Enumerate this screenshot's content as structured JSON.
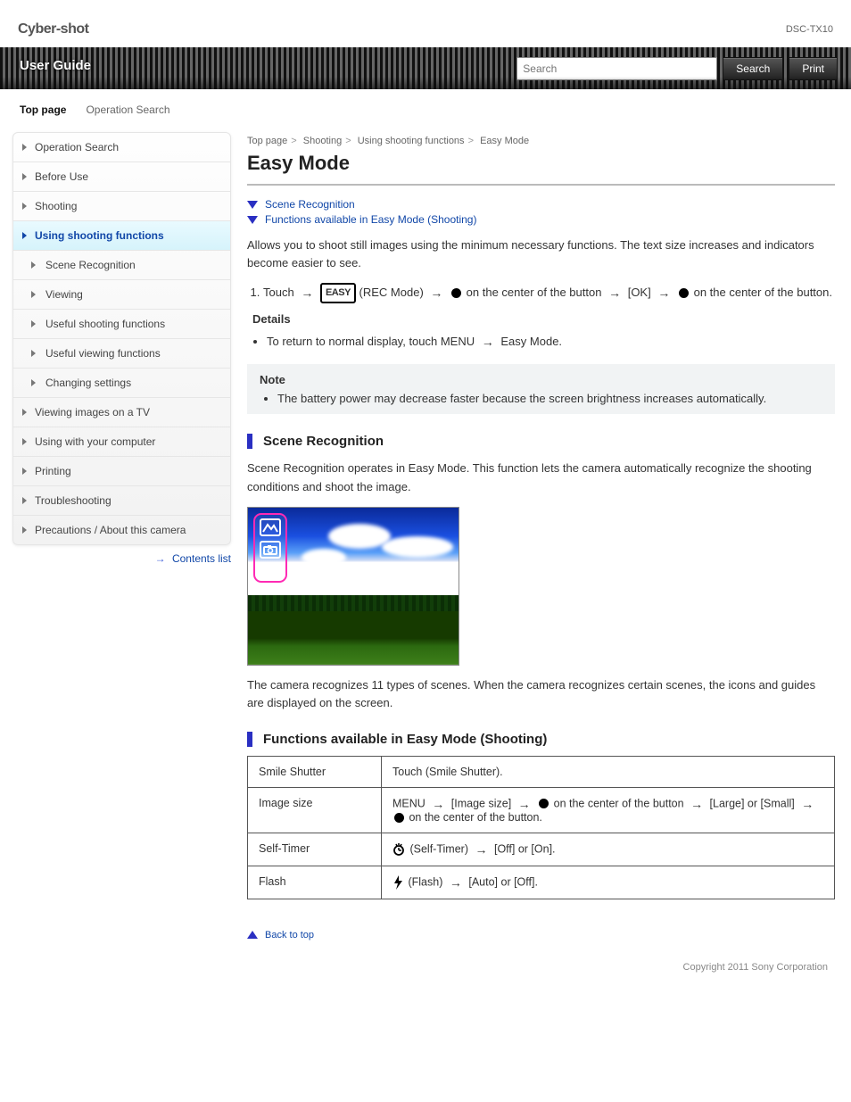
{
  "header": {
    "brand": "Cyber-shot",
    "guide_label": "User Guide",
    "search_placeholder": "Search",
    "search_button": "Search",
    "print_button": "Print",
    "tabs": {
      "top": "Top page",
      "ops": "Operation Search"
    },
    "model_top": "DSC-TX10"
  },
  "sidebar": {
    "items": [
      {
        "label": "Operation Search"
      },
      {
        "label": "Before Use"
      },
      {
        "label": "Shooting"
      },
      {
        "label": "Using shooting functions",
        "active": true
      },
      {
        "label": "Scene Recognition",
        "sub": true
      },
      {
        "label": "Viewing"
      },
      {
        "label": "Useful shooting functions"
      },
      {
        "label": "Useful viewing functions"
      },
      {
        "label": "Changing settings"
      },
      {
        "label": "Viewing images on a TV"
      },
      {
        "label": "Using with your computer"
      },
      {
        "label": "Printing"
      },
      {
        "label": "Troubleshooting"
      },
      {
        "label": "Precautions / About this camera"
      }
    ],
    "back": "Back to top",
    "contents": "Contents list"
  },
  "breadcrumb": {
    "a": "Top page",
    "b": "Shooting",
    "c": "Using shooting functions",
    "d": "Easy Mode"
  },
  "page": {
    "title": "Easy Mode",
    "anchor1": "Scene Recognition",
    "anchor2": "Functions available in Easy Mode (Shooting)",
    "intro": "Allows you to shoot still images using the minimum necessary functions. The text size increases and indicators become easier to see.",
    "steps": {
      "s1a": "Touch",
      "s1b": "(REC Mode)",
      "s1c": "(Easy Mode)",
      "s1d": "on the center of the button",
      "s1e": "[OK]",
      "s1f": "on the center of the button."
    },
    "bullet_details": "To return to normal display, touch MENU",
    "bullet_details2": "Easy Mode.",
    "note": {
      "label": "Note",
      "text": "The battery power may decrease faster because the screen brightness increases automatically."
    },
    "sr": {
      "heading": "Scene Recognition",
      "p1": "Scene Recognition operates in Easy Mode. This function lets the camera automatically recognize the shooting conditions and shoot the image.",
      "p2": "The camera recognizes 11 types of scenes. When the camera recognizes certain scenes, the icons and guides are displayed on the screen."
    },
    "func": {
      "heading": "Functions available in Easy Mode (Shooting)",
      "row1a": "Smile Shutter",
      "row1b": "Touch (Smile Shutter).",
      "row2a": "Image size",
      "row2b_a": "MENU",
      "row2b_b": "[Image size]",
      "row2b_c": "on the center of the button",
      "row2b_d": "[Large] or [Small]",
      "row2b_e": "on the center of the button.",
      "row3a": "Self-Timer",
      "row3b_a": "(Self-Timer)",
      "row3b_b": "[Off] or [On].",
      "row4a": "Flash",
      "row4b_a": "(Flash)",
      "row4b_b": "[Auto] or [Off]."
    },
    "back_top": "Back to top",
    "copyright": "Copyright 2011 Sony Corporation"
  }
}
